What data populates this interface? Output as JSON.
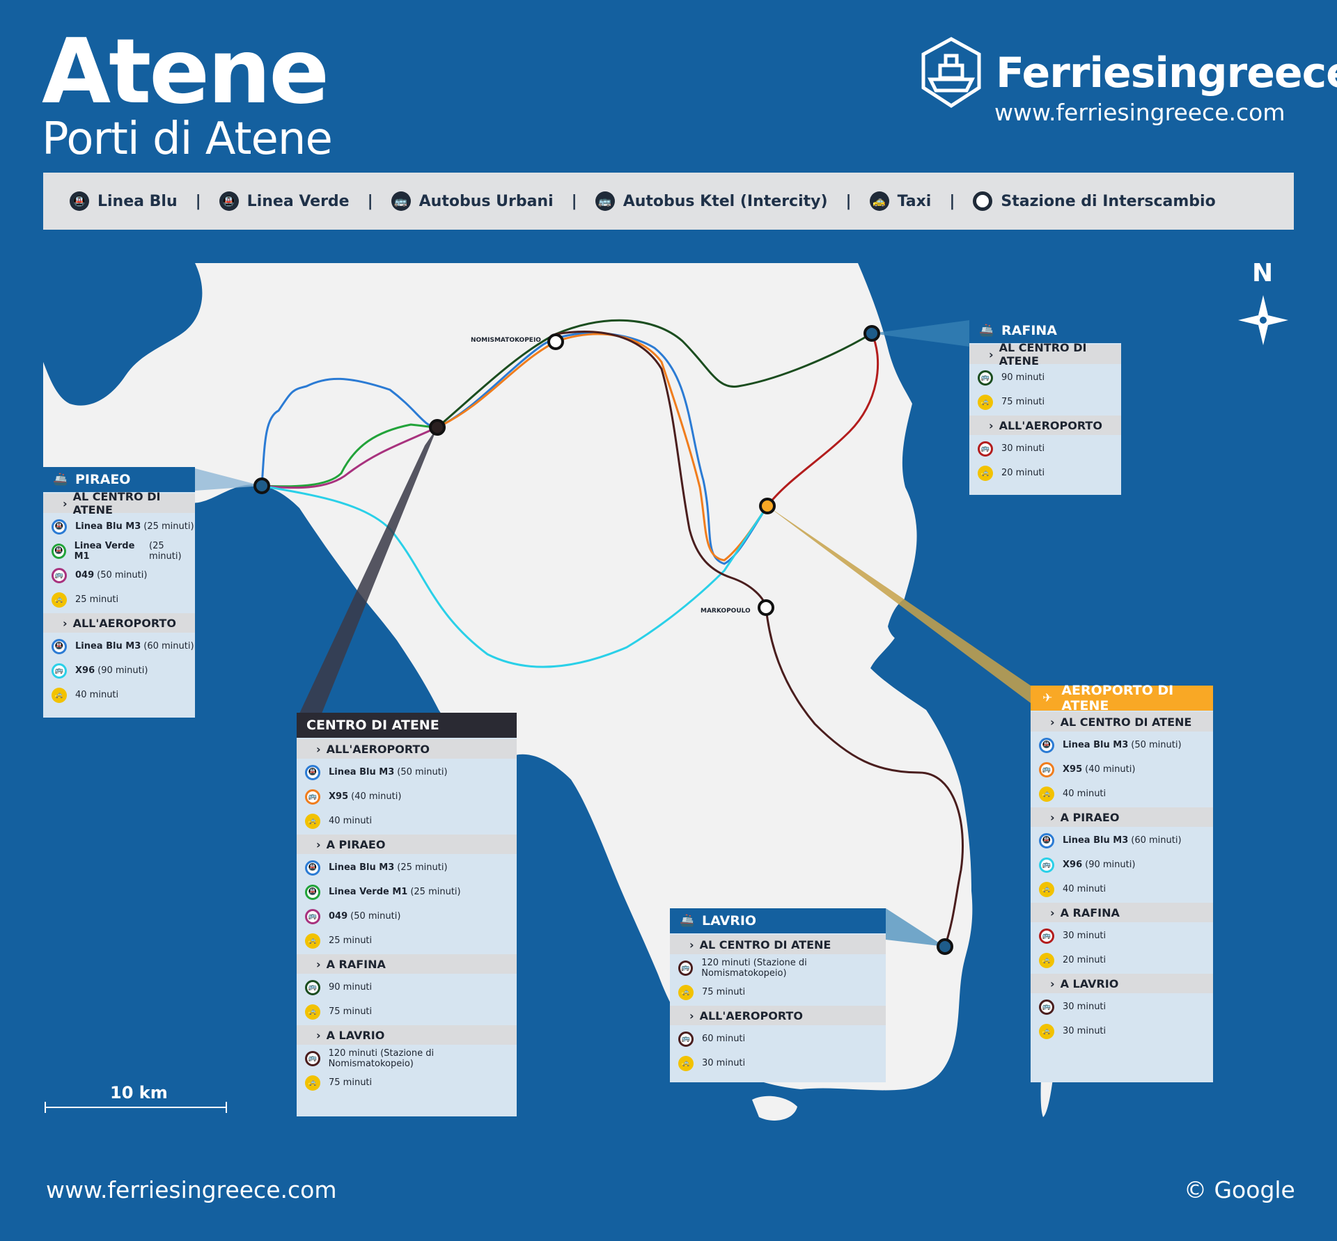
{
  "header": {
    "title": "Atene",
    "subtitle": "Porti di Atene",
    "brand": "Ferriesingreece",
    "brand_url": "www.ferriesingreece.com"
  },
  "legend": {
    "items": [
      {
        "label": "Linea Blu",
        "icon": "train-icon"
      },
      {
        "label": "Linea Verde",
        "icon": "train-icon"
      },
      {
        "label": "Autobus Urbani",
        "icon": "bus-icon"
      },
      {
        "label": "Autobus Ktel (Intercity)",
        "icon": "bus-icon"
      },
      {
        "label": "Taxi",
        "icon": "taxi-icon"
      },
      {
        "label": "Stazione di Interscambio",
        "icon": "station-ring-icon"
      }
    ]
  },
  "map": {
    "north_label": "N",
    "scale_label": "10 km",
    "station_labels": {
      "nomismatokopeio": "NOMISMATOKOPEIO",
      "markopoulo": "MARKOPOULO"
    },
    "watermark": "www.ferriesingreece.com",
    "colors": {
      "sea": "#14609f",
      "land": "#f2f2f2",
      "blue_line": "#2b7bd4",
      "green_line": "#22a33a",
      "purple_line": "#a8327e",
      "dark_green_line": "#1b4d1f",
      "orange_line": "#f07d1d",
      "cyan_line": "#2ad0e8",
      "red_line": "#b31d1d",
      "brown_line": "#4a1e1e",
      "airport_accent": "#f9a825"
    }
  },
  "panels": {
    "piraeo": {
      "title": "PIRAEO",
      "sections": [
        {
          "heading": "AL CENTRO DI ATENE",
          "rows": [
            {
              "bold": "Linea Blu M3",
              "text": "(25 minuti)",
              "icon": "train-icon",
              "color": "#2b7bd4"
            },
            {
              "bold": "Linea Verde M1",
              "text": "(25 minuti)",
              "icon": "train-icon",
              "color": "#22a33a"
            },
            {
              "bold": "049",
              "text": "(50 minuti)",
              "icon": "bus-icon",
              "color": "#a8327e"
            },
            {
              "bold": "",
              "text": "25 minuti",
              "icon": "taxi-icon",
              "color": "#f2c200"
            }
          ]
        },
        {
          "heading": "ALL'AEROPORTO",
          "rows": [
            {
              "bold": "Linea Blu M3",
              "text": "(60 minuti)",
              "icon": "train-icon",
              "color": "#2b7bd4"
            },
            {
              "bold": "X96",
              "text": "(90 minuti)",
              "icon": "bus-icon",
              "color": "#2ad0e8"
            },
            {
              "bold": "",
              "text": "40 minuti",
              "icon": "taxi-icon",
              "color": "#f2c200"
            }
          ]
        }
      ]
    },
    "rafina": {
      "title": "RAFINA",
      "sections": [
        {
          "heading": "AL CENTRO DI ATENE",
          "rows": [
            {
              "bold": "",
              "text": "90 minuti",
              "icon": "bus-icon",
              "color": "#1b4d1f"
            },
            {
              "bold": "",
              "text": "75 minuti",
              "icon": "taxi-icon",
              "color": "#f2c200"
            }
          ]
        },
        {
          "heading": "ALL'AEROPORTO",
          "rows": [
            {
              "bold": "",
              "text": "30 minuti",
              "icon": "bus-icon",
              "color": "#b31d1d"
            },
            {
              "bold": "",
              "text": "20 minuti",
              "icon": "taxi-icon",
              "color": "#f2c200"
            }
          ]
        }
      ]
    },
    "centro": {
      "title": "CENTRO DI ATENE",
      "sections": [
        {
          "heading": "ALL'AEROPORTO",
          "rows": [
            {
              "bold": "Linea Blu M3",
              "text": "(50 minuti)",
              "icon": "train-icon",
              "color": "#2b7bd4"
            },
            {
              "bold": "X95",
              "text": "(40  minuti)",
              "icon": "bus-icon",
              "color": "#f07d1d"
            },
            {
              "bold": "",
              "text": "40 minuti",
              "icon": "taxi-icon",
              "color": "#f2c200"
            }
          ]
        },
        {
          "heading": "A PIRAEO",
          "rows": [
            {
              "bold": "Linea Blu M3",
              "text": "(25 minuti)",
              "icon": "train-icon",
              "color": "#2b7bd4"
            },
            {
              "bold": "Linea Verde M1",
              "text": "(25 minuti)",
              "icon": "train-icon",
              "color": "#22a33a"
            },
            {
              "bold": "049",
              "text": "(50 minuti)",
              "icon": "bus-icon",
              "color": "#a8327e"
            },
            {
              "bold": "",
              "text": "25 minuti",
              "icon": "taxi-icon",
              "color": "#f2c200"
            }
          ]
        },
        {
          "heading": "A RAFINA",
          "rows": [
            {
              "bold": "",
              "text": "90 minuti",
              "icon": "bus-icon",
              "color": "#1b4d1f"
            },
            {
              "bold": "",
              "text": "75 minuti",
              "icon": "taxi-icon",
              "color": "#f2c200"
            }
          ]
        },
        {
          "heading": "A LAVRIO",
          "rows": [
            {
              "bold": "",
              "text": "120 minuti (Stazione di Nomismatokopeio)",
              "icon": "bus-icon",
              "color": "#4a1e1e"
            },
            {
              "bold": "",
              "text": "75 minuti",
              "icon": "taxi-icon",
              "color": "#f2c200"
            }
          ]
        }
      ]
    },
    "lavrio": {
      "title": "LAVRIO",
      "sections": [
        {
          "heading": "AL CENTRO DI ATENE",
          "rows": [
            {
              "bold": "",
              "text": "120 minuti (Stazione di Nomismatokopeio)",
              "icon": "bus-icon",
              "color": "#4a1e1e"
            },
            {
              "bold": "",
              "text": "75 minuti",
              "icon": "taxi-icon",
              "color": "#f2c200"
            }
          ]
        },
        {
          "heading": "ALL'AEROPORTO",
          "rows": [
            {
              "bold": "",
              "text": "60 minuti",
              "icon": "bus-icon",
              "color": "#4a1e1e"
            },
            {
              "bold": "",
              "text": "30 minuti",
              "icon": "taxi-icon",
              "color": "#f2c200"
            }
          ]
        }
      ]
    },
    "aeroporto": {
      "title": "AEROPORTO DI ATENE",
      "sections": [
        {
          "heading": "AL CENTRO DI ATENE",
          "rows": [
            {
              "bold": "Linea Blu M3",
              "text": "(50 minuti)",
              "icon": "train-icon",
              "color": "#2b7bd4"
            },
            {
              "bold": "X95",
              "text": "(40 minuti)",
              "icon": "bus-icon",
              "color": "#f07d1d"
            },
            {
              "bold": "",
              "text": "40 minuti",
              "icon": "taxi-icon",
              "color": "#f2c200"
            }
          ]
        },
        {
          "heading": "A PIRAEO",
          "rows": [
            {
              "bold": "Linea Blu M3",
              "text": "(60 minuti)",
              "icon": "train-icon",
              "color": "#2b7bd4"
            },
            {
              "bold": "X96",
              "text": "(90 minuti)",
              "icon": "bus-icon",
              "color": "#2ad0e8"
            },
            {
              "bold": "",
              "text": "40 minuti",
              "icon": "taxi-icon",
              "color": "#f2c200"
            }
          ]
        },
        {
          "heading": "A RAFINA",
          "rows": [
            {
              "bold": "",
              "text": "30 minuti",
              "icon": "bus-icon",
              "color": "#b31d1d"
            },
            {
              "bold": "",
              "text": "20 minuti",
              "icon": "taxi-icon",
              "color": "#f2c200"
            }
          ]
        },
        {
          "heading": "A LAVRIO",
          "rows": [
            {
              "bold": "",
              "text": "30 minuti",
              "icon": "bus-icon",
              "color": "#4a1e1e"
            },
            {
              "bold": "",
              "text": "30 minuti",
              "icon": "taxi-icon",
              "color": "#f2c200"
            }
          ]
        }
      ]
    }
  },
  "footer": {
    "url": "www.ferriesingreece.com",
    "copyright": "© Google"
  }
}
